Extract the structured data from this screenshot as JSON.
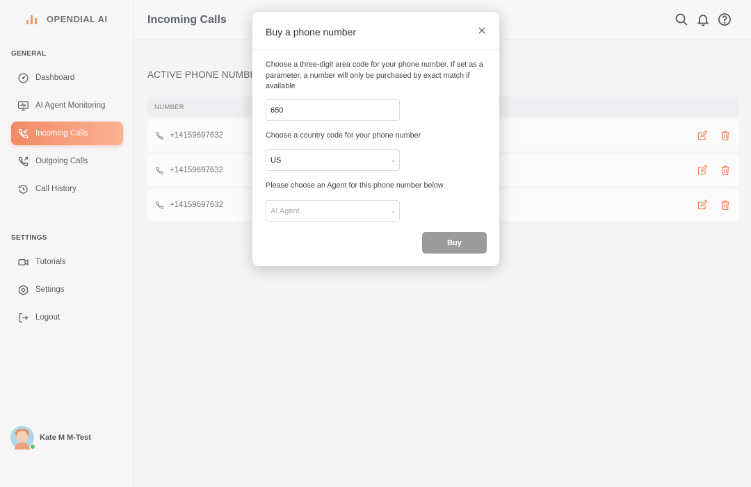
{
  "app": {
    "brand": "OPENDIAL AI",
    "accent_color": "#f27a3d"
  },
  "sidebar": {
    "general_label": "GENERAL",
    "general_items": [
      {
        "label": "Dashboard",
        "icon": "dashboard-gauge-icon"
      },
      {
        "label": "AI Agent Monitoring",
        "icon": "monitor-icon"
      },
      {
        "label": "Incoming Calls",
        "icon": "incoming-call-icon",
        "active": true
      },
      {
        "label": "Outgoing Calls",
        "icon": "outgoing-call-icon"
      },
      {
        "label": "Call History",
        "icon": "history-icon"
      }
    ],
    "settings_label": "SETTINGS",
    "settings_items": [
      {
        "label": "Tutorials",
        "icon": "video-icon"
      },
      {
        "label": "Settings",
        "icon": "settings-hexagon-icon"
      },
      {
        "label": "Logout",
        "icon": "logout-icon"
      }
    ],
    "user": {
      "name": "Kate M  M-Test",
      "status": "online"
    }
  },
  "header": {
    "title": "Incoming Calls",
    "icons": [
      "search-icon",
      "bell-icon",
      "help-icon"
    ]
  },
  "main": {
    "heading": "ACTIVE PHONE NUMBI",
    "table": {
      "column_header": "NUMBER",
      "rows": [
        {
          "number": "+14159697632"
        },
        {
          "number": "+14159697632"
        },
        {
          "number": "+14159697632"
        }
      ]
    }
  },
  "modal": {
    "title": "Buy a phone number",
    "area_code_help": "Choose a three-digit area code for your phone number. If set as a parameter, a number will only be purchased by exact match if available",
    "area_code_value": "650",
    "country_help": "Choose a country code for your phone number",
    "country_value": "US",
    "agent_help": "Please choose an Agent for this phone number below",
    "agent_placeholder": "AI Agent",
    "buy_label": "Buy"
  }
}
